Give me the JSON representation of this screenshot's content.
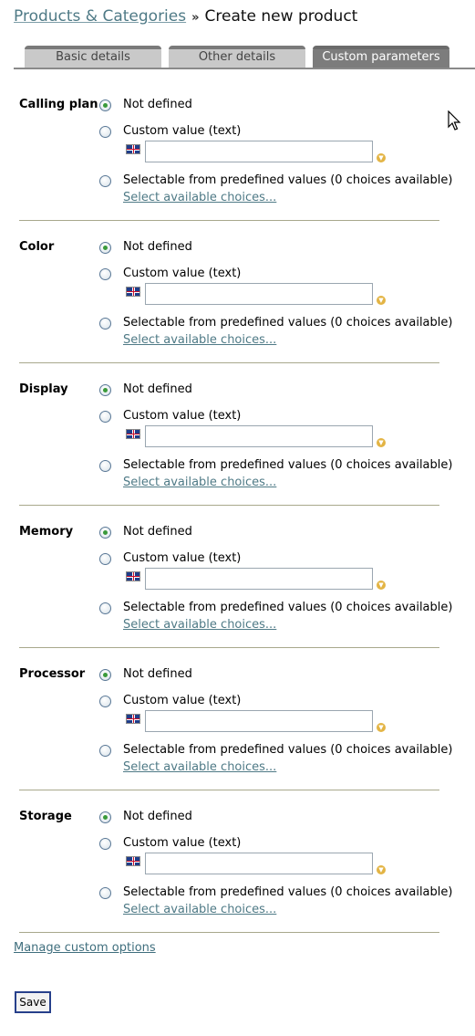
{
  "header": {
    "breadcrumb": "Products & Categories",
    "separator": "»",
    "title": "Create new product"
  },
  "tabs": [
    {
      "label": "Basic details",
      "active": false
    },
    {
      "label": "Other details",
      "active": false
    },
    {
      "label": "Custom parameters",
      "active": true
    }
  ],
  "options": {
    "not_defined": "Not defined",
    "custom_value": "Custom value (text)",
    "selectable": "Selectable from predefined values (0 choices available)",
    "select_link": "Select available choices..."
  },
  "parameters": [
    {
      "name": "Calling plan",
      "selected": "not_defined",
      "custom_text": ""
    },
    {
      "name": "Color",
      "selected": "not_defined",
      "custom_text": ""
    },
    {
      "name": "Display",
      "selected": "not_defined",
      "custom_text": ""
    },
    {
      "name": "Memory",
      "selected": "not_defined",
      "custom_text": ""
    },
    {
      "name": "Processor",
      "selected": "not_defined",
      "custom_text": ""
    },
    {
      "name": "Storage",
      "selected": "not_defined",
      "custom_text": ""
    }
  ],
  "footer": {
    "manage_link": "Manage custom options",
    "save_label": "Save"
  },
  "colors": {
    "link": "#3f6e7d",
    "active_tab": "#7c7c7c",
    "inactive_tab": "#c9c9c9",
    "radio_checked": "#3a9a3a"
  },
  "icons": {
    "flag": "uk-flag-icon",
    "dot": "info-dot-icon",
    "cursor": "mouse-pointer-icon"
  }
}
